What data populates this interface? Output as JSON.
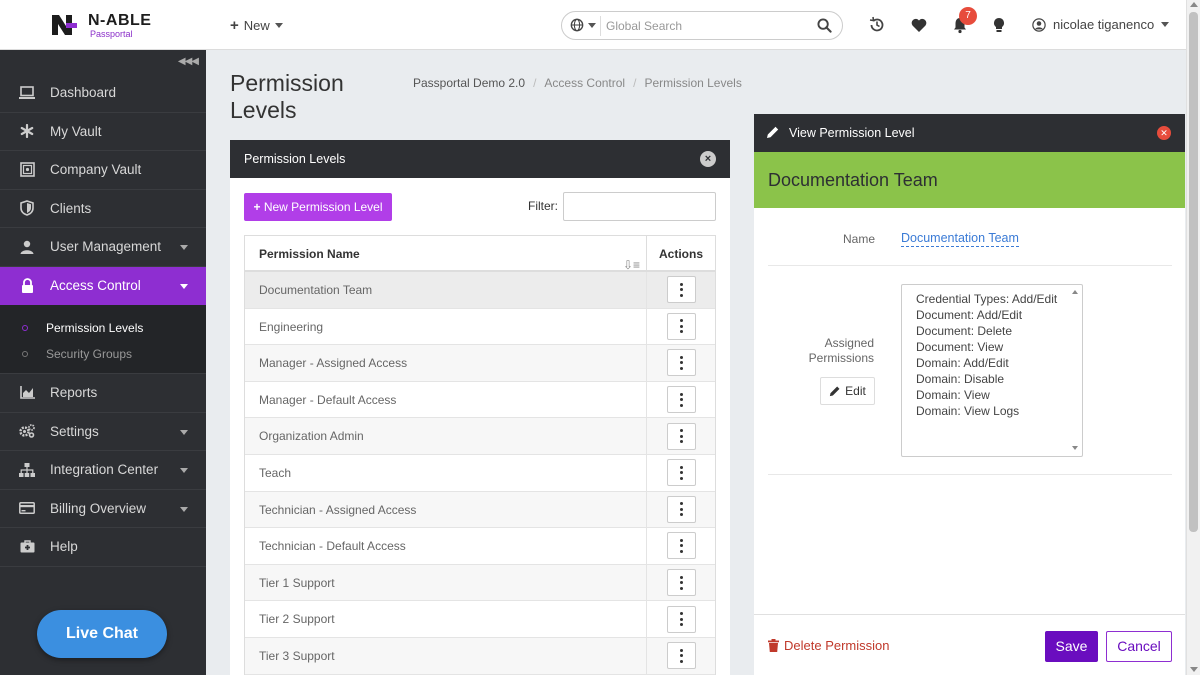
{
  "app": {
    "logo_text": "N-ABLE",
    "logo_sub": "Passportal",
    "accent": "#8e2ed1"
  },
  "topbar": {
    "new_label": "New",
    "search_placeholder": "Global Search",
    "notification_count": "7",
    "user_name": "nicolae tiganenco",
    "icons": [
      "globe-icon",
      "search-icon",
      "history-icon",
      "heart-icon",
      "bell-icon",
      "lightbulb-icon",
      "user-icon"
    ]
  },
  "sidebar": {
    "items": [
      {
        "label": "Dashboard",
        "icon": "laptop-icon",
        "caret": false
      },
      {
        "label": "My Vault",
        "icon": "asterisk-icon",
        "caret": false
      },
      {
        "label": "Company Vault",
        "icon": "safe-icon",
        "caret": false
      },
      {
        "label": "Clients",
        "icon": "shield-icon",
        "caret": false
      },
      {
        "label": "User Management",
        "icon": "user-icon",
        "caret": true
      },
      {
        "label": "Access Control",
        "icon": "lock-icon",
        "caret": true,
        "active": true
      }
    ],
    "subitems": [
      {
        "label": "Permission Levels",
        "active": true
      },
      {
        "label": "Security Groups",
        "active": false
      }
    ],
    "items_after": [
      {
        "label": "Reports",
        "icon": "chart-icon",
        "caret": false
      },
      {
        "label": "Settings",
        "icon": "cogs-icon",
        "caret": true
      },
      {
        "label": "Integration Center",
        "icon": "sitemap-icon",
        "caret": true
      },
      {
        "label": "Billing Overview",
        "icon": "credit-card-icon",
        "caret": true
      },
      {
        "label": "Help",
        "icon": "medkit-icon",
        "caret": false
      }
    ],
    "live_chat": "Live Chat"
  },
  "page": {
    "title": "Permission Levels",
    "breadcrumb": [
      "Passportal Demo 2.0",
      "Access Control",
      "Permission Levels"
    ]
  },
  "left_panel": {
    "title": "Permission Levels",
    "new_button": "New Permission Level",
    "filter_label": "Filter:",
    "filter_value": "",
    "columns": [
      "Permission Name",
      "Actions"
    ],
    "rows": [
      "Documentation Team",
      "Engineering",
      "Manager - Assigned Access",
      "Manager - Default Access",
      "Organization Admin",
      "Teach",
      "Technician - Assigned Access",
      "Technician - Default Access",
      "Tier 1 Support",
      "Tier 2 Support",
      "Tier 3 Support"
    ]
  },
  "right_panel": {
    "title": "View Permission Level",
    "header_name": "Documentation Team",
    "name_label": "Name",
    "name_value": "Documentation Team",
    "assigned_label": "Assigned Permissions",
    "edit_label": "Edit",
    "permissions": [
      "Credential Types: Add/Edit",
      "Document: Add/Edit",
      "Document: Delete",
      "Document: View",
      "Domain: Add/Edit",
      "Domain: Disable",
      "Domain: View",
      "Domain: View Logs"
    ],
    "delete_label": "Delete Permission",
    "save_label": "Save",
    "cancel_label": "Cancel",
    "header_color": "#8bc34a"
  }
}
